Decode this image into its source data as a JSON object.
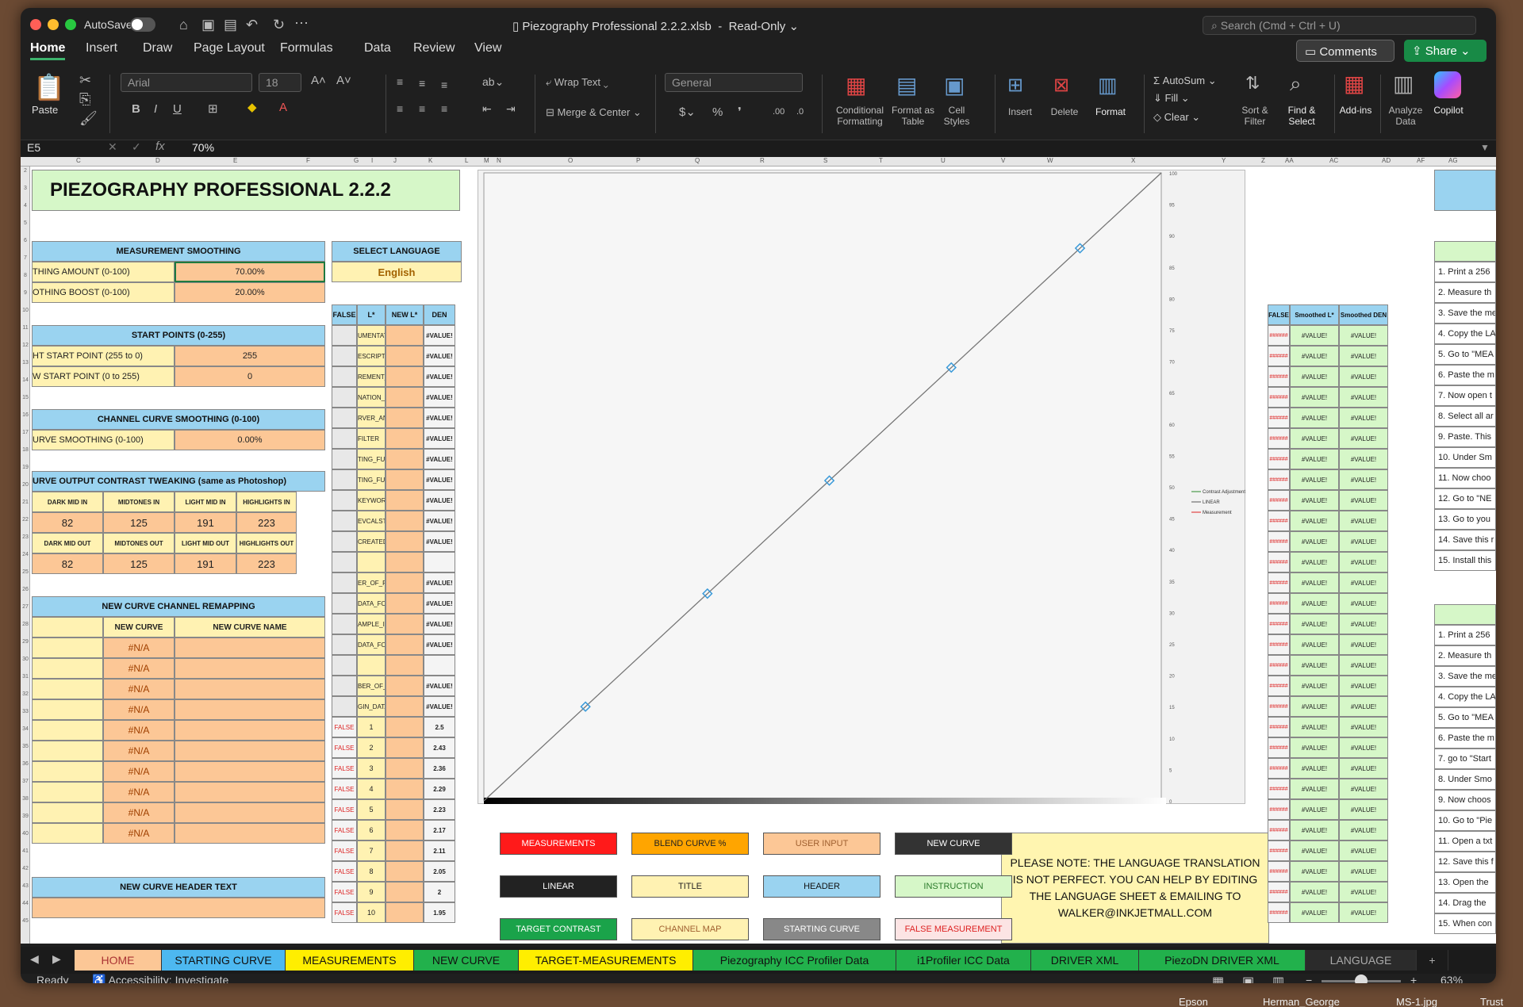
{
  "titlebar": {
    "autosave": "AutoSave",
    "doc": "Piezography Professional 2.2.2.xlsb",
    "mode": "Read-Only",
    "search": "Search (Cmd + Ctrl + U)"
  },
  "tabs": [
    "Home",
    "Insert",
    "Draw",
    "Page Layout",
    "Formulas",
    "Data",
    "Review",
    "View"
  ],
  "ribbon": {
    "comments": "Comments",
    "share": "Share",
    "paste": "Paste",
    "font": "Arial",
    "size": "18",
    "wrap": "Wrap Text",
    "merge": "Merge & Center",
    "numfmt": "General",
    "cond": "Conditional Formatting",
    "fmt_table": "Format as Table",
    "cell_styles": "Cell Styles",
    "insert": "Insert",
    "delete": "Delete",
    "format": "Format",
    "autosum": "AutoSum",
    "fill": "Fill",
    "clear": "Clear",
    "sort": "Sort & Filter",
    "find": "Find & Select",
    "addins": "Add-ins",
    "analyze": "Analyze Data",
    "copilot": "Copilot"
  },
  "formula": {
    "namebox": "E5",
    "value": "70%"
  },
  "cols": [
    "C",
    "D",
    "E",
    "F",
    "G",
    "I",
    "J",
    "K",
    "L",
    "M",
    "N",
    "O",
    "P",
    "Q",
    "R",
    "S",
    "T",
    "U",
    "V",
    "W",
    "X",
    "Y",
    "Z",
    "AA",
    "AC",
    "AD",
    "AF",
    "AG"
  ],
  "sheet": {
    "title": "PIEZOGRAPHY PROFESSIONAL 2.2.2",
    "ms_hdr": "MEASUREMENT SMOOTHING",
    "ms1_l": "THING AMOUNT (0-100)",
    "ms1_v": "70.00%",
    "ms2_l": "OTHING BOOST (0-100)",
    "ms2_v": "20.00%",
    "lang_hdr": "SELECT LANGUAGE",
    "lang": "English",
    "sp_hdr": "START POINTS (0-255)",
    "sp1_l": "HT START POINT (255 to 0)",
    "sp1_v": "255",
    "sp2_l": "W START POINT (0 to 255)",
    "sp2_v": "0",
    "cc_hdr": "CHANNEL CURVE SMOOTHING (0-100)",
    "cc_l": "URVE SMOOTHING (0-100)",
    "cc_v": "0.00%",
    "ct_hdr": "URVE OUTPUT CONTRAST TWEAKING (same as Photoshop)",
    "ct_in": [
      "DARK MID IN",
      "MIDTONES IN",
      "LIGHT MID IN",
      "HIGHLIGHTS IN"
    ],
    "ct_in_v": [
      "82",
      "125",
      "191",
      "223"
    ],
    "ct_out": [
      "DARK MID OUT",
      "MIDTONES OUT",
      "LIGHT MID OUT",
      "HIGHLIGHTS OUT"
    ],
    "ct_out_v": [
      "82",
      "125",
      "191",
      "223"
    ],
    "rm_hdr": "NEW CURVE CHANNEL REMAPPING",
    "rm_c1": "NEW CURVE",
    "rm_c2": "NEW CURVE NAME",
    "na": "#N/A",
    "hdrtext": "NEW CURVE HEADER TEXT",
    "mid_cols": [
      "FALSE",
      "L*",
      "NEW L*",
      "DEN"
    ],
    "mid_keys": [
      "UMENTATION",
      "ESCRIPTOR",
      "REMENT_SOURCE",
      "NATION_NAME",
      "RVER_ANGLE",
      "FILTER",
      "TING_FUNCTION",
      "TING_FUNCTION",
      "KEYWORD",
      "EVCALSTD",
      "CREATED",
      "",
      "ER_OF_FIELDS",
      "DATA_FORMAT",
      "AMPLE_ID",
      "DATA_FORMAT",
      "",
      "BER_OF_SETS",
      "GIN_DATA"
    ],
    "val_err": "#VALUE!",
    "false": "FALSE",
    "num_rows": [
      [
        "1",
        "2.5"
      ],
      [
        "2",
        "2.43"
      ],
      [
        "3",
        "2.36"
      ],
      [
        "4",
        "2.29"
      ],
      [
        "5",
        "2.23"
      ],
      [
        "6",
        "2.17"
      ],
      [
        "7",
        "2.11"
      ],
      [
        "8",
        "2.05"
      ],
      [
        "9",
        "2"
      ],
      [
        "10",
        "1.95"
      ]
    ],
    "right_cols": [
      "FALSE",
      "Smoothed L*",
      "Smoothed DEN"
    ],
    "hash": "######",
    "inst1": [
      "1. Print a 256",
      "2. Measure th",
      "3. Save the me",
      "4. Copy the LA",
      "5. Go to \"MEA",
      "6. Paste the m",
      "7. Now open t",
      "8. Select all ar",
      "9. Paste. This",
      "10. Under Sm",
      "11. Now choo",
      "12. Go to \"NE",
      "13. Go to you",
      "14. Save this r",
      "15. Install this"
    ],
    "inst2": [
      "1. Print a 256",
      "2. Measure th",
      "3. Save the me",
      "4. Copy the LA",
      "5. Go to \"MEA",
      "6. Paste the m",
      "7. go to \"Start",
      "8. Under Smo",
      "9. Now choos",
      "10. Go to \"Pie",
      "11. Open a txt",
      "12. Save this f",
      "13. Open the",
      "14. Drag the",
      "15. When con"
    ],
    "legend": [
      "MEASUREMENTS",
      "BLEND CURVE %",
      "USER INPUT",
      "NEW CURVE",
      "LINEAR",
      "TITLE",
      "HEADER",
      "INSTRUCTION",
      "TARGET CONTRAST",
      "CHANNEL MAP",
      "STARTING CURVE",
      "FALSE MEASUREMENT"
    ],
    "note": "PLEASE NOTE: THE LANGUAGE TRANSLATION IS NOT PERFECT.        YOU CAN HELP BY EDITING THE LANGUAGE SHEET & EMAILING TO WALKER@INKJETMALL.COM"
  },
  "chart_data": {
    "type": "line",
    "x": [
      0,
      15,
      33,
      51,
      69,
      88,
      100
    ],
    "series": [
      {
        "name": "Contrast Adjustment",
        "values": [
          0,
          15,
          33,
          51,
          69,
          88,
          100
        ]
      },
      {
        "name": "LINEAR",
        "values": [
          0,
          15,
          33,
          51,
          69,
          88,
          100
        ]
      }
    ],
    "legend_extra": "Measurement",
    "yticks": [
      "100",
      "95",
      "90",
      "85",
      "80",
      "75",
      "70",
      "65",
      "60",
      "55",
      "50",
      "45",
      "40",
      "35",
      "30",
      "25",
      "20",
      "15",
      "10",
      "5",
      "0"
    ],
    "ylim": [
      0,
      100
    ],
    "xlim": [
      0,
      100
    ]
  },
  "sheets": [
    "HOME",
    "STARTING CURVE",
    "MEASUREMENTS",
    "NEW CURVE",
    "TARGET-MEASUREMENTS",
    "Piezography ICC Profiler Data",
    "i1Profiler ICC Data",
    "DRIVER XML",
    "PiezoDN DRIVER XML",
    "LANGUAGE"
  ],
  "status": {
    "ready": "Ready",
    "access": "Accessibility: Investigate",
    "zoom": "63%"
  },
  "desktop": [
    "Epson",
    "Herman_George",
    "MS-1.jpg",
    "Trust"
  ]
}
